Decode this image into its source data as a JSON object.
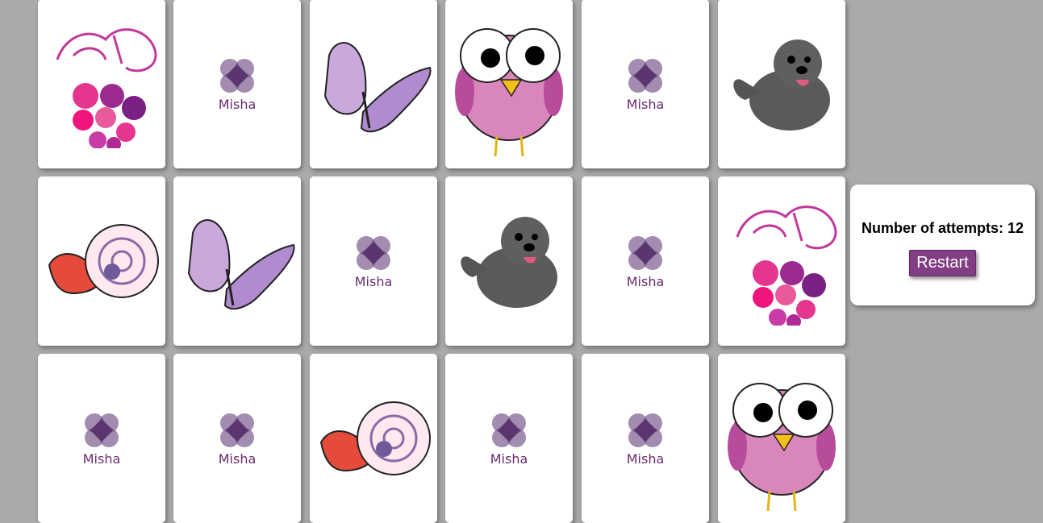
{
  "game": {
    "brand_label": "Misha",
    "attempts_text": "Number of attempts: 12",
    "restart_label": "Restart",
    "colors": {
      "background": "#aaaaaa",
      "accent": "#813e85",
      "card_back_mark": "#6a2c6e"
    }
  },
  "cards": [
    {
      "state": "face-up",
      "image": "grapes"
    },
    {
      "state": "face-down"
    },
    {
      "state": "face-up",
      "image": "butterfly"
    },
    {
      "state": "face-up",
      "image": "bird"
    },
    {
      "state": "face-down"
    },
    {
      "state": "face-up",
      "image": "seal"
    },
    {
      "state": "face-up",
      "image": "snail"
    },
    {
      "state": "face-up",
      "image": "butterfly"
    },
    {
      "state": "face-down"
    },
    {
      "state": "face-up",
      "image": "seal"
    },
    {
      "state": "face-down"
    },
    {
      "state": "face-up",
      "image": "grapes"
    },
    {
      "state": "face-down"
    },
    {
      "state": "face-down"
    },
    {
      "state": "face-up",
      "image": "snail"
    },
    {
      "state": "face-down"
    },
    {
      "state": "face-down"
    },
    {
      "state": "face-up",
      "image": "bird"
    }
  ]
}
